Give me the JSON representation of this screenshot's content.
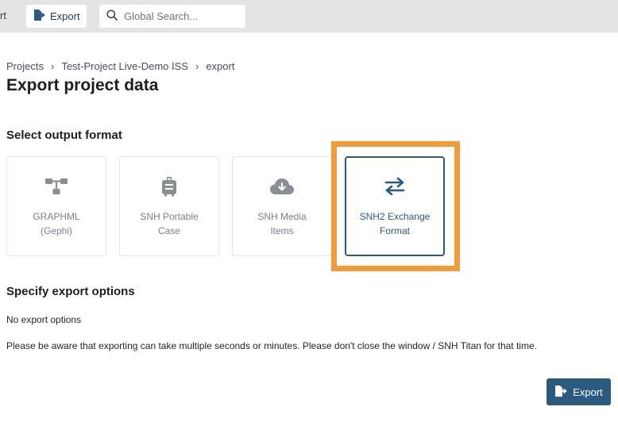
{
  "topbar": {
    "partial_label": "rt",
    "export_label": "Export",
    "search_placeholder": "Global Search..."
  },
  "breadcrumb": [
    "Projects",
    "Test-Project Live-Demo ISS",
    "export"
  ],
  "page_title": "Export project data",
  "output_section": {
    "title": "Select output format",
    "formats": [
      {
        "line1": "GRAPHML",
        "line2": "(Gephi)",
        "icon": "sitemap-icon",
        "selected": false
      },
      {
        "line1": "SNH Portable",
        "line2": "Case",
        "icon": "suitcase-icon",
        "selected": false
      },
      {
        "line1": "SNH Media",
        "line2": "Items",
        "icon": "cloud-download-icon",
        "selected": false
      },
      {
        "line1": "SNH2 Exchange",
        "line2": "Format",
        "icon": "exchange-arrows-icon",
        "selected": true
      }
    ]
  },
  "options_section": {
    "title": "Specify export options",
    "no_options": "No export options",
    "notice": "Please be aware that exporting can take multiple seconds or minutes. Please don't close the window / SNH Titan for that time."
  },
  "export_button_label": "Export",
  "colors": {
    "accent": "#2b5a80",
    "highlight": "#f29b38",
    "icon_gray": "#8a8f96",
    "topbar": "#e3e4e6"
  }
}
